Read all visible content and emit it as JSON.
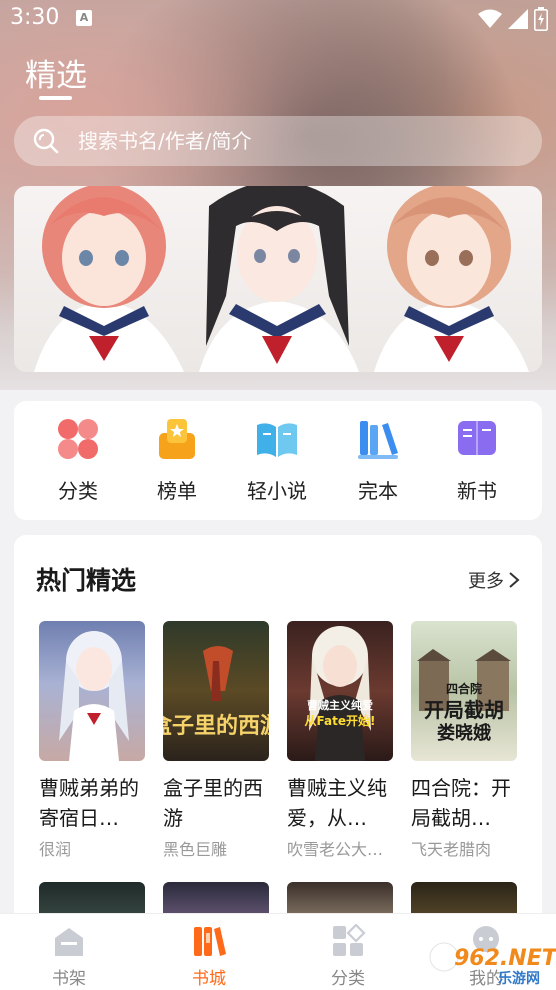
{
  "status_bar": {
    "time": "3:30",
    "badge": "A"
  },
  "page": {
    "title": "精选"
  },
  "search": {
    "placeholder": "搜索书名/作者/简介"
  },
  "categories": [
    {
      "label": "分类",
      "icon": "grid-icon",
      "color": "#f26b6b"
    },
    {
      "label": "榜单",
      "icon": "ranking-icon",
      "color": "#f7a21b"
    },
    {
      "label": "轻小说",
      "icon": "open-book-icon",
      "color": "#3fb0e8"
    },
    {
      "label": "完本",
      "icon": "books-icon",
      "color": "#3b8df0"
    },
    {
      "label": "新书",
      "icon": "new-book-icon",
      "color": "#8a6cf0"
    }
  ],
  "hot": {
    "title": "热门精选",
    "more_label": "更多",
    "books": [
      {
        "title": "曹贼弟弟的寄宿日…",
        "author": "很润"
      },
      {
        "title": "盒子里的西游",
        "author": "黑色巨雕",
        "cover_text": "盒子里的西游"
      },
      {
        "title": "曹贼主义纯爱，从…",
        "author": "吹雪老公大…",
        "cover_text_1": "曹贼主义纯爱",
        "cover_text_2": "从Fate开始!"
      },
      {
        "title": "四合院：开局截胡…",
        "author": "飞天老腊肉",
        "cover_text_1": "四合院",
        "cover_text_2": "开局截胡",
        "cover_text_3": "娄晓娥"
      }
    ]
  },
  "tabbar": {
    "tabs": [
      {
        "label": "书架",
        "active": false
      },
      {
        "label": "书城",
        "active": true
      },
      {
        "label": "分类",
        "active": false
      },
      {
        "label": "我的",
        "active": false
      }
    ]
  },
  "watermark": {
    "text": "962.NET",
    "subtext": "乐游网"
  },
  "colors": {
    "accent": "#ff6a1a",
    "text_primary": "#1a1a1a",
    "text_secondary": "#999999"
  }
}
